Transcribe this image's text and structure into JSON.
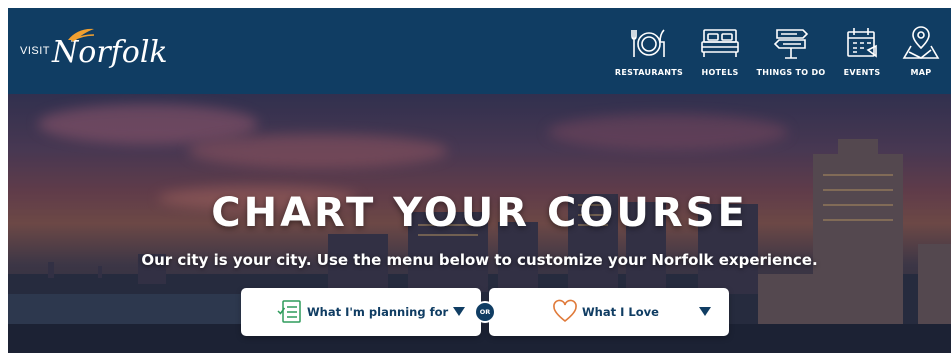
{
  "header": {
    "logo": {
      "visit": "VISIT",
      "name": "Norfolk"
    },
    "nav": [
      {
        "id": "restaurants",
        "label": "RESTAURANTS",
        "icon": "plate-fork-knife-icon"
      },
      {
        "id": "hotels",
        "label": "HOTELS",
        "icon": "bed-icon"
      },
      {
        "id": "things",
        "label": "THINGS TO DO",
        "icon": "signpost-icon"
      },
      {
        "id": "events",
        "label": "EVENTS",
        "icon": "calendar-icon"
      },
      {
        "id": "map",
        "label": "MAP",
        "icon": "map-pin-icon"
      }
    ]
  },
  "hero": {
    "title": "CHART YOUR COURSE",
    "subtitle": "Our city is your city. Use the menu below to customize your Norfolk experience.",
    "planning_select": {
      "label": "What I'm planning for",
      "icon": "checklist-icon"
    },
    "or_label": "OR",
    "love_select": {
      "label": "What I Love",
      "icon": "heart-icon"
    }
  },
  "colors": {
    "header_bg": "#103d63",
    "text_light": "#ffffff",
    "select_text": "#103d63",
    "checklist_icon": "#2e9b5b",
    "heart_icon": "#e07a3a"
  }
}
